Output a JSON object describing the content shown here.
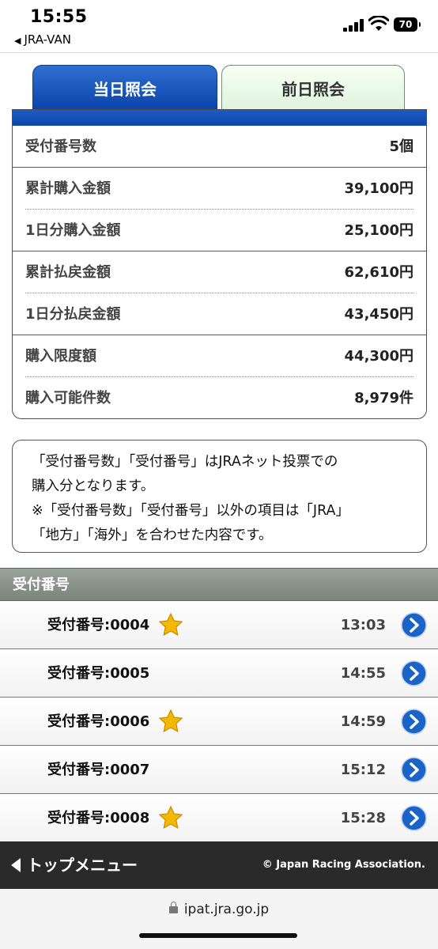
{
  "status_bar": {
    "time": "15:55",
    "back_app": "JRA-VAN",
    "battery": "70"
  },
  "tabs": [
    {
      "label": "当日照会",
      "active": true
    },
    {
      "label": "前日照会",
      "active": false
    }
  ],
  "summary": [
    {
      "label": "受付番号数",
      "value": "5個"
    },
    {
      "label": "累計購入金額",
      "value": "39,100円"
    },
    {
      "label": "1日分購入金額",
      "value": "25,100円"
    },
    {
      "label": "累計払戻金額",
      "value": "62,610円"
    },
    {
      "label": "1日分払戻金額",
      "value": "43,450円"
    },
    {
      "label": "購入限度額",
      "value": "44,300円"
    },
    {
      "label": "購入可能件数",
      "value": "8,979件"
    }
  ],
  "notice": {
    "line1": "「受付番号数」「受付番号」はJRAネット投票での",
    "line2": "購入分となります。",
    "line3": "※「受付番号数」「受付番号」以外の項目は「JRA」",
    "line4": "「地方」「海外」を合わせた内容です。"
  },
  "receipts_header": "受付番号",
  "receipts": [
    {
      "label": "受付番号:0004",
      "time": "13:03",
      "starred": true
    },
    {
      "label": "受付番号:0005",
      "time": "14:55",
      "starred": false
    },
    {
      "label": "受付番号:0006",
      "time": "14:59",
      "starred": true
    },
    {
      "label": "受付番号:0007",
      "time": "15:12",
      "starred": false
    },
    {
      "label": "受付番号:0008",
      "time": "15:28",
      "starred": true
    }
  ],
  "footer": {
    "menu_label": "トップメニュー",
    "copyright": "© Japan Racing Association."
  },
  "url": "ipat.jra.go.jp",
  "colors": {
    "tab_active": "#0a42a8",
    "tab_inactive": "#def3dc",
    "section_header": "#7a857a",
    "footer": "#2a2a2a",
    "star": "#f5b800",
    "arrow": "#1c63c8"
  }
}
